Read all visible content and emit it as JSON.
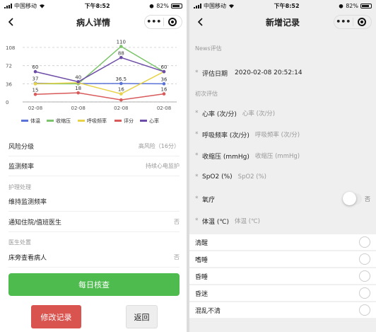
{
  "left": {
    "status": {
      "carrier": "中国移动",
      "time": "下午8:52",
      "battery": "82%"
    },
    "nav": {
      "title": "病人详情",
      "more": "•••"
    },
    "chart_data": {
      "type": "line",
      "categories": [
        "02-08",
        "02-08",
        "02-08",
        "02-08"
      ],
      "y_ticks": [
        "108",
        "72",
        "36",
        "0"
      ],
      "ylim": [
        0,
        108
      ],
      "grid": true,
      "legend_position": "bottom",
      "series": [
        {
          "name": "体温",
          "color": "#5b73d6",
          "values": [
            37,
            36.5,
            36.5,
            36
          ],
          "labels": [
            "37",
            "",
            "36.5",
            "36"
          ]
        },
        {
          "name": "收缩压",
          "color": "#7cc46b",
          "values": [
            36,
            36,
            110,
            60
          ],
          "labels": [
            "",
            "",
            "110",
            ""
          ]
        },
        {
          "name": "呼吸频率",
          "color": "#e8d24a",
          "values": [
            36,
            38,
            16,
            60
          ],
          "labels": [
            "",
            "",
            "16",
            ""
          ]
        },
        {
          "name": "评分",
          "color": "#d95a5a",
          "values": [
            15,
            18,
            4,
            16
          ],
          "labels": [
            "15",
            "18",
            "",
            "16"
          ]
        },
        {
          "name": "心率",
          "color": "#6d4ca8",
          "values": [
            60,
            40,
            88,
            60
          ],
          "labels": [
            "60",
            "40",
            "88",
            "60"
          ]
        }
      ]
    },
    "rows": {
      "risk_label": "风险分级",
      "risk_value": "高风险（16分）",
      "freq_label": "监测频率",
      "freq_value": "持续心电监护",
      "nursing_section": "护理处理",
      "maintain": "维持监测频率",
      "notify_label": "通知住院/值班医生",
      "notify_value": "否",
      "doctor_section": "医生处置",
      "bedside_label": "床旁查看病人",
      "bedside_value": "否"
    },
    "buttons": {
      "daily": "每日核查",
      "modify": "修改记录",
      "back": "返回"
    }
  },
  "right": {
    "status": {
      "carrier": "中国移动",
      "time": "下午8:52",
      "battery": "82%"
    },
    "nav": {
      "title": "新增记录"
    },
    "news_section": "News评估",
    "date_label": "评估日期",
    "date_value": "2020-02-08 20:52:14",
    "initial_section": "初次评估",
    "fields": [
      {
        "label": "心率 (次/分)",
        "placeholder": "心率 (次/分)"
      },
      {
        "label": "呼吸频率 (次/分)",
        "placeholder": "呼吸频率 (次/分)"
      },
      {
        "label": "收缩压 (mmHg)",
        "placeholder": "收缩压 (mmHg)"
      },
      {
        "label": "SpO2 (%)",
        "placeholder": "SpO2 (%)"
      }
    ],
    "oxygen_label": "氧疗",
    "oxygen_value": "否",
    "temp_label": "体温 (℃)",
    "temp_placeholder": "体温 (℃)",
    "options": [
      "清醒",
      "嗜睡",
      "昏睡",
      "昏迷",
      "混乱不清"
    ]
  }
}
